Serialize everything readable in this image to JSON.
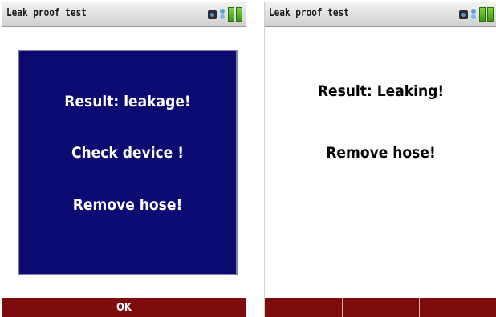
{
  "left_screen": {
    "title": "Leak proof test",
    "status_icons": [
      "sensor-icon",
      "wireless-icon",
      "battery-icon"
    ],
    "panel_color": "#0b0b72",
    "messages": [
      "Result: leakage!",
      "Check device !",
      "Remove hose!"
    ],
    "softkeys": [
      "",
      "OK",
      ""
    ]
  },
  "right_screen": {
    "title": "Leak proof test",
    "status_icons": [
      "sensor-icon",
      "wireless-icon",
      "battery-icon"
    ],
    "messages": [
      "Result: Leaking!",
      "Remove hose!"
    ],
    "softkeys": [
      "",
      "",
      ""
    ]
  },
  "colors": {
    "softkey_bar": "#7e0c0c",
    "battery": "#4caf1c"
  }
}
